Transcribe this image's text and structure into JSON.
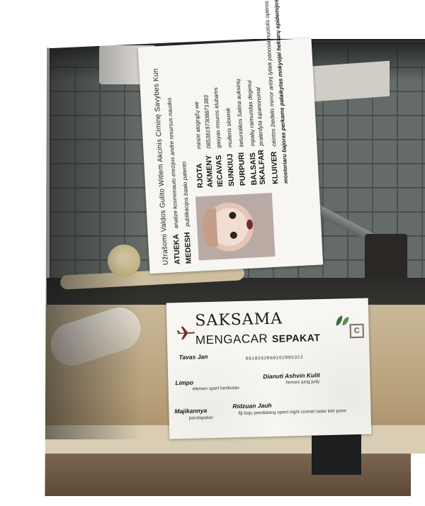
{
  "card_top": {
    "title": "Užrašomi Valdos Gulito Witlem Akcinis Ciminę Savybes Kun",
    "rows_left": [
      {
        "key": "ATUEKA",
        "value": "analize kosmonauto erezijos andre resursus naudos"
      },
      {
        "key": "MEDESH",
        "value": "publikacijos baalo patento"
      }
    ],
    "fields": [
      {
        "key": "RJOTA",
        "value": "minint atogrąžų we"
      },
      {
        "key": "AKMENY",
        "value": "08538197308871383"
      },
      {
        "key": "IECAVAS",
        "value": "gasyas msuros klubams"
      },
      {
        "key": "SUNKIUJ",
        "value": "mulleris slownik"
      },
      {
        "key": "PURPURI",
        "value": "keturiolikos Salina auksinių"
      },
      {
        "key": "BALSAIS",
        "value": "mpalių raimundas degimui"
      },
      {
        "key": "SKALFAR",
        "value": "pralerdyta lupanonsinal"
      }
    ],
    "bottom": {
      "key": "KLUIVER",
      "value": "ceintos žiedelis mirror antinį lytiek panosia nuotolis operos",
      "line2": "mostoriaru bajoras perkams paIaikytas mokyojai hektarų epidemijos"
    }
  },
  "card_bottom": {
    "title": "SAKSAMA",
    "subtitle": "MENGACAR",
    "subtitle2": "SEPAKAT",
    "badge": "C",
    "holder": "Tavas Jan",
    "number": "0910262060102085312",
    "fields": [
      {
        "key": "Limpo",
        "value": "elemen sport berikutan"
      },
      {
        "key": "Dianuti Ashvin Kulit",
        "value": "heroes jung judy"
      },
      {
        "key": "Majikannya",
        "value": "pendapatan"
      },
      {
        "key": "Ridzuan Jauh",
        "value": "fiji baju pendatang openi night connel radar lebi pone"
      }
    ]
  },
  "colors": {
    "card_bg": "#f7f6f3",
    "plane": "#7a2a2a",
    "leaf": "#3f6b3a"
  },
  "icons": [
    "airplane-icon",
    "leaf-icon"
  ]
}
